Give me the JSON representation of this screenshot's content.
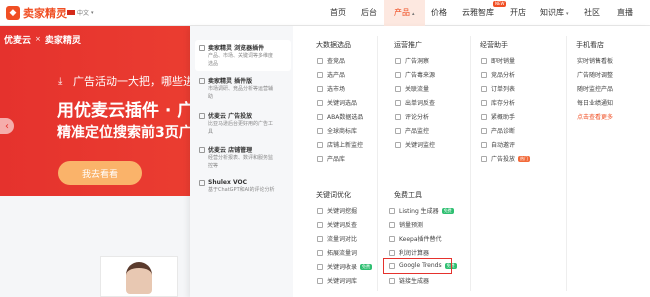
{
  "nav": {
    "logo_text": "卖家精灵",
    "lang": "中文",
    "links": [
      "首页",
      "后台",
      "产品",
      "价格",
      "云雅智库",
      "开店",
      "知识库",
      "社区",
      "直播"
    ],
    "new_badge": "NEW"
  },
  "hero": {
    "brand_left": "优麦云",
    "brand_x": "×",
    "brand_right": "卖家精灵",
    "ad_line": "广告活动一大把，哪些进",
    "title": "用优麦云插件 · 广",
    "subtitle": "精准定位搜索前3页广",
    "button": "我去看看"
  },
  "products": [
    {
      "name": "卖家精灵 浏览器插件",
      "desc1": "产品、市场、关键词等多维度",
      "desc2": "选品"
    },
    {
      "name": "卖家精灵 插件版",
      "desc1": "市场调研、竞品分析等运营辅",
      "desc2": "助"
    },
    {
      "name": "优麦云 广告投放",
      "desc1": "比亚马逊后台更好用的广告工",
      "desc2": "具"
    },
    {
      "name": "优麦云 店铺管理",
      "desc1": "经营分析报表、数评和服务监",
      "desc2": "控等"
    },
    {
      "name": "Shulex VOC",
      "desc1": "基于ChatGPT和AI的评论分析",
      "desc2": ""
    }
  ],
  "columns": {
    "big_data": {
      "title": "大数据选品",
      "items": [
        "查竞品",
        "选产品",
        "选市场",
        "关键词选品",
        "ABA数据选品",
        "全球商标库",
        "店铺上新监控",
        "产品库"
      ]
    },
    "ops": {
      "title": "运营推广",
      "items": [
        "广告洞察",
        "广告毒来源",
        "关联流量",
        "出单词反查",
        "评论分析",
        "产品监控",
        "关键词监控",
        "广告投放"
      ]
    },
    "biz": {
      "title": "经营助手",
      "items": [
        "即时销量",
        "竞品分析",
        "订单列表",
        "库存分析",
        "紧概助手",
        "产品诊断",
        "自动邀评"
      ]
    },
    "mobile": {
      "title": "手机看店",
      "items": [
        "实时销售看板",
        "广告随时调整",
        "随时监控产品",
        "每日业绩通知",
        "点击查看更多"
      ]
    },
    "kw": {
      "title": "关键词优化",
      "items": [
        "关键词挖掘",
        "关键词反查",
        "流量词对比",
        "拓展流量词",
        "关键词收录",
        "关键词词库"
      ]
    },
    "tools": {
      "title": "免费工具",
      "items": [
        "Listing 生成器",
        "销量预测",
        "Keepa插件替代",
        "利润计算器",
        "Google Trends",
        "链接生成器"
      ]
    }
  },
  "tags": {
    "free": "免费",
    "hot": "热门"
  },
  "colors": {
    "brand": "#f04f24",
    "hero_start": "#e5322d",
    "hero_end": "#f45e3f",
    "button": "#fab36a"
  }
}
